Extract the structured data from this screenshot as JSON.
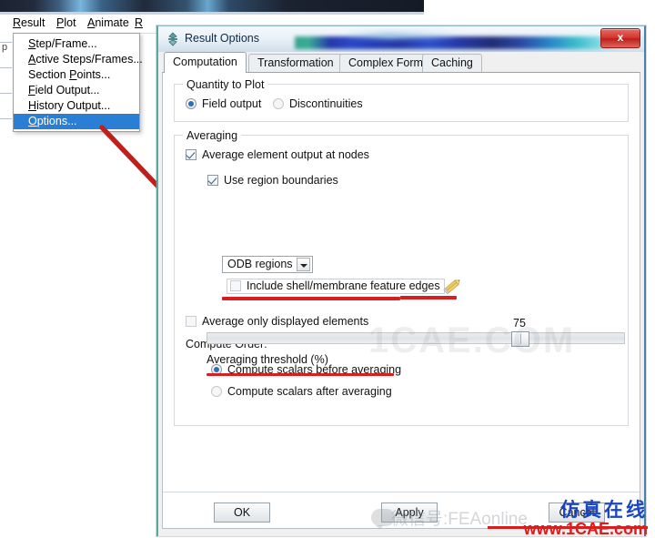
{
  "app": {
    "menubar": [
      {
        "label": "Result",
        "mnemonic": "R"
      },
      {
        "label": "Plot",
        "mnemonic": "P"
      },
      {
        "label": "Animate",
        "mnemonic": "A"
      },
      {
        "label": "R",
        "mnemonic": "R"
      }
    ],
    "result_menu": {
      "items": [
        {
          "label": "Step/Frame...",
          "mnemonic": "S",
          "selected": false
        },
        {
          "label": "Active Steps/Frames...",
          "mnemonic": "A",
          "selected": false
        },
        {
          "label": "Section Points...",
          "mnemonic": "P",
          "selected": false
        },
        {
          "label": "Field Output...",
          "mnemonic": "F",
          "selected": false
        },
        {
          "label": "History Output...",
          "mnemonic": "H",
          "selected": false
        },
        {
          "label": "Options...",
          "mnemonic": "O",
          "selected": true
        }
      ]
    }
  },
  "dialog": {
    "title": "Result Options",
    "close_label": "x",
    "icon_name": "abaqus-diamond-icon",
    "tabs": [
      {
        "label": "Computation",
        "active": true
      },
      {
        "label": "Transformation",
        "active": false
      },
      {
        "label": "Complex Form",
        "active": false
      },
      {
        "label": "Caching",
        "active": false
      }
    ],
    "quantity_group": {
      "title": "Quantity to Plot",
      "options": [
        {
          "label": "Field output",
          "checked": true
        },
        {
          "label": "Discontinuities",
          "checked": false
        }
      ]
    },
    "averaging_group": {
      "title": "Averaging",
      "average_element_output": {
        "label": "Average element output at nodes",
        "checked": true
      },
      "use_region_boundaries": {
        "label": "Use region boundaries",
        "checked": true
      },
      "region_source": {
        "value": "ODB regions",
        "options": [
          "ODB regions"
        ]
      },
      "shell_feature_edges": {
        "label": "Include shell/membrane feature edges",
        "checked": false
      },
      "average_only_displayed": {
        "label": "Average only displayed elements",
        "checked": false
      },
      "compute_order_label": "Compute Order:",
      "compute_order": [
        {
          "label": "Compute scalars before averaging",
          "checked": true
        },
        {
          "label": "Compute scalars after averaging",
          "checked": false
        }
      ],
      "threshold": {
        "label": "Averaging threshold (%)",
        "value": "75",
        "percent": 75,
        "min": 0,
        "max": 100
      }
    },
    "buttons": [
      {
        "label": "OK"
      },
      {
        "label": "Apply"
      },
      {
        "label": "Cancel"
      }
    ]
  },
  "annotations": {
    "arrow_name": "red-arrow-pointing-to-region-boundaries",
    "pencil_name": "pencil-highlight-icon",
    "accent_red": "#d81f1f",
    "highlight_blue": "#2a7fd4"
  },
  "watermarks": {
    "center": "1CAE.COM",
    "weixin": "微信号:FEAonline",
    "brand_cn": "仿真在线",
    "brand_url": "www.1CAE.com"
  }
}
